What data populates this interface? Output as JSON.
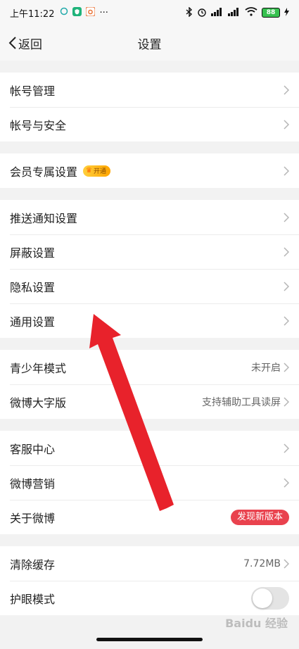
{
  "statusbar": {
    "time": "上午11:22",
    "dots": "···",
    "battery": "88"
  },
  "nav": {
    "back_label": "返回",
    "title": "设置"
  },
  "groups": [
    {
      "items": [
        {
          "label": "帐号管理"
        },
        {
          "label": "帐号与安全"
        }
      ]
    },
    {
      "items": [
        {
          "label": "会员专属设置",
          "badge": "开通"
        }
      ]
    },
    {
      "items": [
        {
          "label": "推送通知设置"
        },
        {
          "label": "屏蔽设置"
        },
        {
          "label": "隐私设置"
        },
        {
          "label": "通用设置"
        }
      ]
    },
    {
      "items": [
        {
          "label": "青少年模式",
          "value": "未开启"
        },
        {
          "label": "微博大字版",
          "value": "支持辅助工具读屏"
        }
      ]
    },
    {
      "items": [
        {
          "label": "客服中心"
        },
        {
          "label": "微博营销"
        },
        {
          "label": "关于微博",
          "tag": "发现新版本"
        }
      ]
    },
    {
      "items": [
        {
          "label": "清除缓存",
          "value": "7.72MB"
        },
        {
          "label": "护眼模式",
          "toggle": false
        }
      ]
    }
  ],
  "watermark": "Baidu 经验",
  "colors": {
    "accent_red": "#e9424e",
    "arrow_red": "#e8222b"
  }
}
